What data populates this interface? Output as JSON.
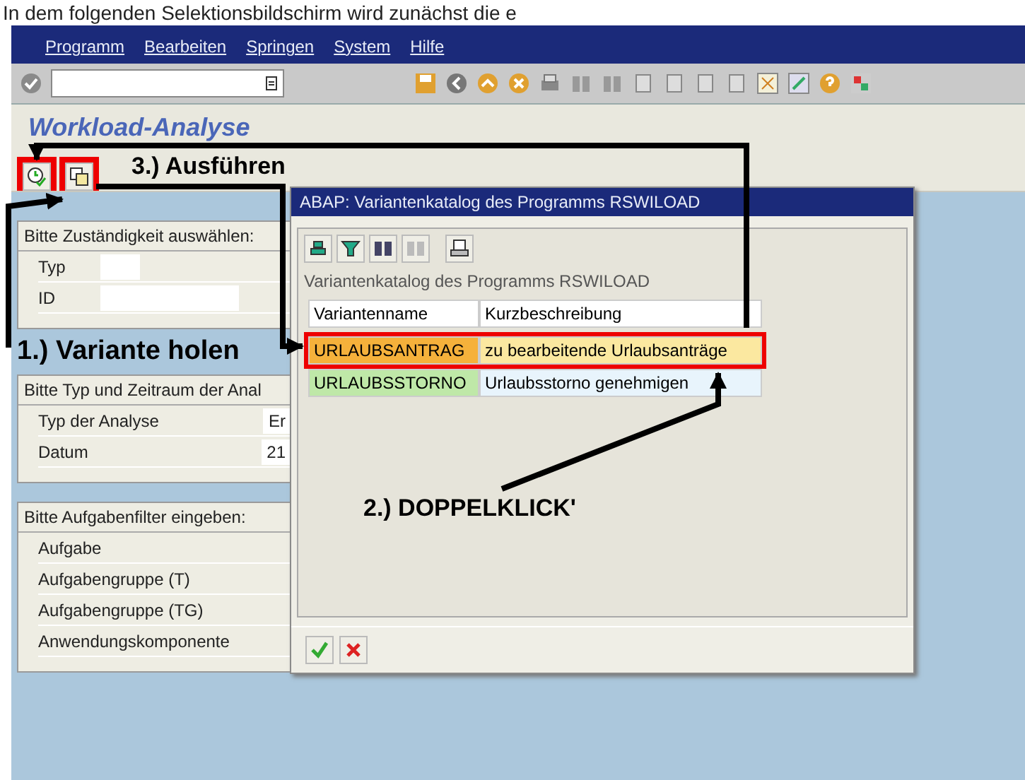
{
  "doc_text": "In dem folgenden Selektionsbildschirm wird zunächst die e",
  "menu": [
    "Programm",
    "Bearbeiten",
    "Springen",
    "System",
    "Hilfe"
  ],
  "screen_title": "Workload-Analyse",
  "panels": [
    {
      "title": "Bitte Zuständigkeit auswählen:",
      "rows": [
        {
          "kind": "input",
          "label": "Typ"
        },
        {
          "kind": "input",
          "label": "ID"
        }
      ]
    },
    {
      "title": "Bitte Typ und Zeitraum der Anal",
      "rows": [
        {
          "kind": "value",
          "label": "Typ der Analyse",
          "value": "Er"
        },
        {
          "kind": "value",
          "label": "Datum",
          "value": "21"
        }
      ]
    },
    {
      "title": "Bitte Aufgabenfilter eingeben:",
      "rows": [
        {
          "kind": "plain",
          "label": "Aufgabe"
        },
        {
          "kind": "plain",
          "label": "Aufgabengruppe (T)"
        },
        {
          "kind": "plain",
          "label": "Aufgabengruppe (TG)"
        },
        {
          "kind": "plain",
          "label": "Anwendungskomponente"
        }
      ]
    }
  ],
  "dialog": {
    "title": "ABAP: Variantenkatalog des Programms RSWILOAD",
    "heading": "Variantenkatalog des Programms RSWILOAD",
    "columns": [
      "Variantenname",
      "Kurzbeschreibung"
    ],
    "rows": [
      {
        "name": "URLAUBSANTRAG",
        "description": "zu bearbeitende Urlaubsanträge",
        "selected": true
      },
      {
        "name": "URLAUBSSTORNO",
        "description": "Urlaubsstorno genehmigen",
        "selected": false
      }
    ]
  },
  "annotations": [
    "1.) Variante holen",
    "2.) DOPPELKLICK'",
    "3.) Ausführen"
  ]
}
